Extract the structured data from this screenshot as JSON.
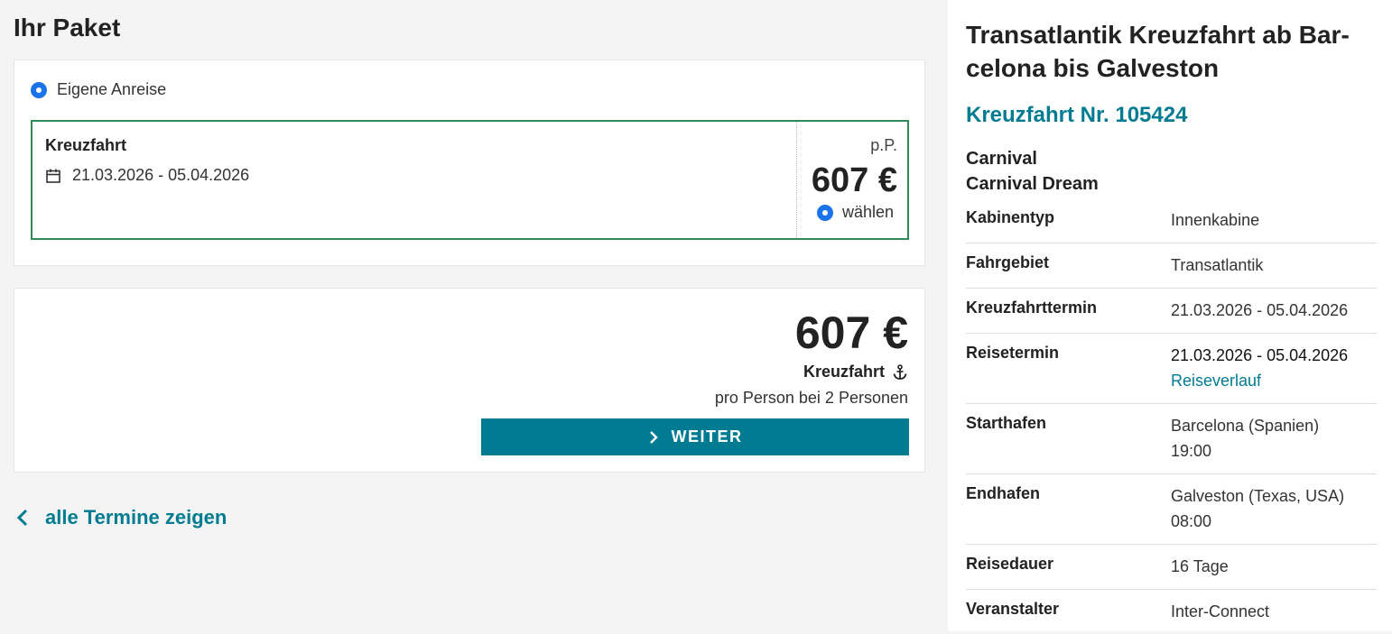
{
  "page_title": "Ihr Paket",
  "package": {
    "arrival_option": "Eigene Anreise",
    "offer": {
      "name": "Kreuzfahrt",
      "dates": "21.03.2026 - 05.04.2026",
      "per_person_label": "p.P.",
      "price": "607 €",
      "select_label": "wählen"
    }
  },
  "summary": {
    "price": "607 €",
    "label": "Kreuzfahrt",
    "sub": "pro Person bei 2 Personen",
    "button": "WEITER"
  },
  "back_link": "alle Termine zeigen",
  "details": {
    "title": "Transatlantik Kreuzfahrt ab Bar-celona bis Galveston",
    "subtitle": "Kreuzfahrt Nr. 105424",
    "carrier": "Carnival",
    "ship": "Carnival Dream",
    "rows": [
      {
        "label": "Kabinentyp",
        "value": "Innenkabine"
      },
      {
        "label": "Fahrgebiet",
        "value": "Transatlantik"
      },
      {
        "label": "Kreuzfahrttermin",
        "value": "21.03.2026 - 05.04.2026"
      },
      {
        "label": "Reisetermin",
        "value": "21.03.2026 - 05.04.2026",
        "link": "Reiseverlauf"
      },
      {
        "label": "Starthafen",
        "value": "Barcelona (Spanien)",
        "value2": "19:00"
      },
      {
        "label": "Endhafen",
        "value": "Galveston (Texas, USA)",
        "value2": "08:00"
      },
      {
        "label": "Reisedauer",
        "value": "16 Tage"
      },
      {
        "label": "Veranstalter",
        "value": "Inter-Connect"
      }
    ]
  },
  "colors": {
    "accent": "#007b91",
    "radio": "#1a73e8",
    "selected_border": "#2e8b57"
  },
  "icons": {
    "calendar": "calendar-icon",
    "anchor": "anchor-icon",
    "chevron_right": "chevron-right-icon",
    "chevron_left": "chevron-left-icon"
  }
}
